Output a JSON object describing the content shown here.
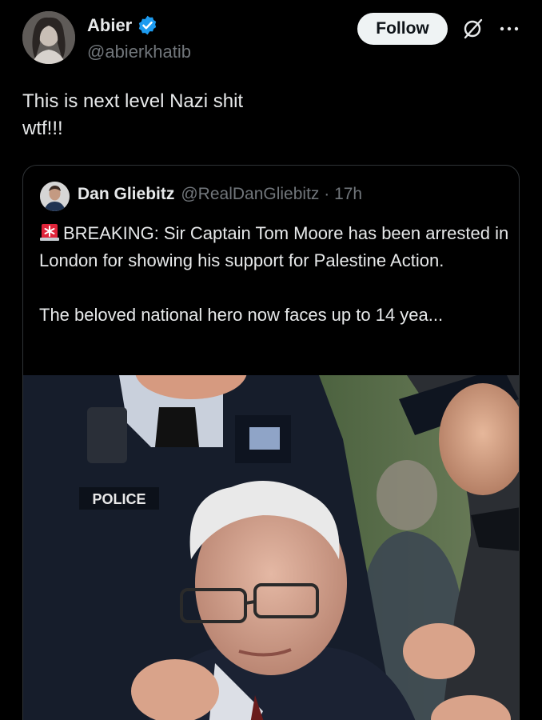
{
  "author": {
    "name": "Abier",
    "handle": "@abierkhatib"
  },
  "actions": {
    "follow_label": "Follow"
  },
  "tweet": {
    "text": "This is next level Nazi shit\nwtf!!!"
  },
  "quoted": {
    "name": "Dan Gliebitz",
    "meta": "@RealDanGliebitz · 17h",
    "text": "BREAKING: Sir Captain Tom Moore has been arrested in London for showing his support for Palestine Action.\n\nThe beloved national hero now faces up to 14 yea...",
    "image_text": "POLICE"
  },
  "colors": {
    "background": "#000000",
    "verified": "#1d9bf0",
    "muted": "#71767b"
  },
  "icons": [
    "verified-badge-icon",
    "grok-icon",
    "more-icon",
    "siren-icon"
  ]
}
